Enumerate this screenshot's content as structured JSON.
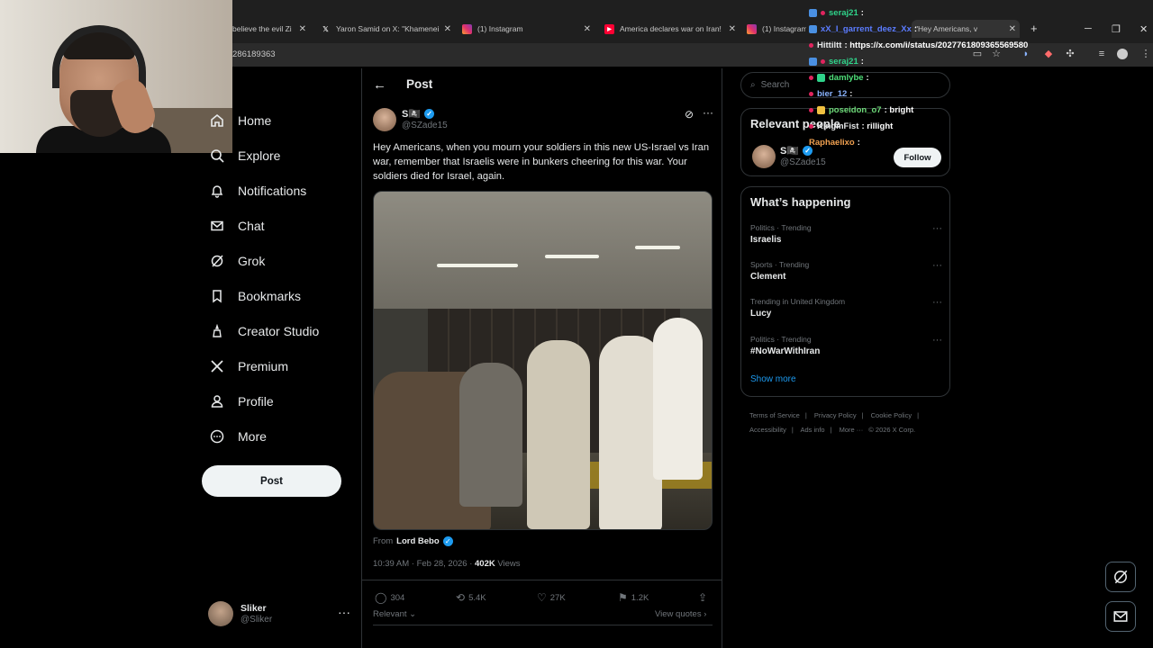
{
  "browser": {
    "tabs": [
      {
        "title": "believe the evil Zi",
        "favicon": "tab-icon"
      },
      {
        "title": "Yaron Samid on X: \"Khamenei",
        "favicon": "x-logo-icon"
      },
      {
        "title": "(1) Instagram",
        "favicon": "instagram-icon"
      },
      {
        "title": "America declares war on Iran!",
        "favicon": "youtube-icon"
      },
      {
        "title": "(1) Instagram",
        "favicon": "instagram-icon"
      },
      {
        "title": "\"Hey Americans, v",
        "favicon": "x-logo-icon"
      }
    ],
    "url_fragment": "286189363"
  },
  "nav": {
    "items": [
      {
        "label": "Home",
        "icon": "home-icon"
      },
      {
        "label": "Explore",
        "icon": "search-icon"
      },
      {
        "label": "Notifications",
        "icon": "bell-icon"
      },
      {
        "label": "Chat",
        "icon": "mail-icon"
      },
      {
        "label": "Grok",
        "icon": "grok-icon"
      },
      {
        "label": "Bookmarks",
        "icon": "bookmark-icon"
      },
      {
        "label": "Creator Studio",
        "icon": "creator-icon"
      },
      {
        "label": "Premium",
        "icon": "x-logo-icon"
      },
      {
        "label": "Profile",
        "icon": "person-icon"
      },
      {
        "label": "More",
        "icon": "more-circle-icon"
      }
    ],
    "post_button": "Post",
    "account": {
      "name": "Sliker",
      "handle": "@Sliker"
    }
  },
  "post": {
    "header": "Post",
    "author_name": "S🏴‍☠️",
    "author_handle": "@SZade15",
    "text": "Hey Americans, when you mourn your soldiers in this new US-Israel vs Iran war, remember that Israelis were in bunkers cheering for this war. Your soldiers died for Israel, again.",
    "from_label": "From",
    "from_name": "Lord Bebo",
    "timestamp": "10:39 AM · Feb 28, 2026 · ",
    "views_count": "402K",
    "views_label": "Views",
    "replies": "304",
    "reposts": "5.4K",
    "likes": "27K",
    "bookmarks": "1.2K",
    "sort_label": "Relevant",
    "view_quotes": "View quotes ›"
  },
  "sidebar": {
    "search_placeholder": "Search",
    "relevant_title": "Relevant people",
    "relevant_person": {
      "name": "S🏴‍☠️",
      "handle": "@SZade15",
      "follow": "Follow"
    },
    "happening_title": "What’s happening",
    "trends": [
      {
        "category": "Politics · Trending",
        "topic": "Israelis"
      },
      {
        "category": "Sports · Trending",
        "topic": "Clement"
      },
      {
        "category": "Trending in United Kingdom",
        "topic": "Lucy"
      },
      {
        "category": "Politics · Trending",
        "topic": "#NoWarWithIran"
      }
    ],
    "show_more": "Show more",
    "footer": [
      "Terms of Service",
      "|",
      "Privacy Policy",
      "|",
      "Cookie Policy",
      "|",
      "Accessibility",
      "|",
      "Ads info",
      "|",
      "More ···",
      "© 2026 X Corp."
    ]
  },
  "chat": [
    {
      "user": "seraj21",
      "msg": ":",
      "color": "#2fd38a"
    },
    {
      "user": "xX_I_garrent_deez_Xx",
      "msg": ":",
      "color": "#5b7cff"
    },
    {
      "user": "Hittiltt",
      "msg": ": https://x.com/i/status/2027761809365569580",
      "color": "#e7e9ea"
    },
    {
      "user": "seraj21",
      "msg": ":",
      "color": "#2fd38a"
    },
    {
      "user": "damlybe",
      "msg": ":",
      "color": "#4fe07a"
    },
    {
      "user": "bier_12",
      "msg": ":",
      "color": "#8ab4ff"
    },
    {
      "user": "poseidon_o7",
      "msg": ": bright",
      "color": "#6fdc7a"
    },
    {
      "user": "KingmFist",
      "msg": ": rillight",
      "color": "#e7e9ea"
    },
    {
      "user": "Raphaelixo",
      "msg": ":",
      "color": "#f0a050"
    }
  ],
  "colors": {
    "accent": "#1d9bf0",
    "background": "#000000",
    "border": "#2f3336",
    "muted": "#71767b"
  }
}
